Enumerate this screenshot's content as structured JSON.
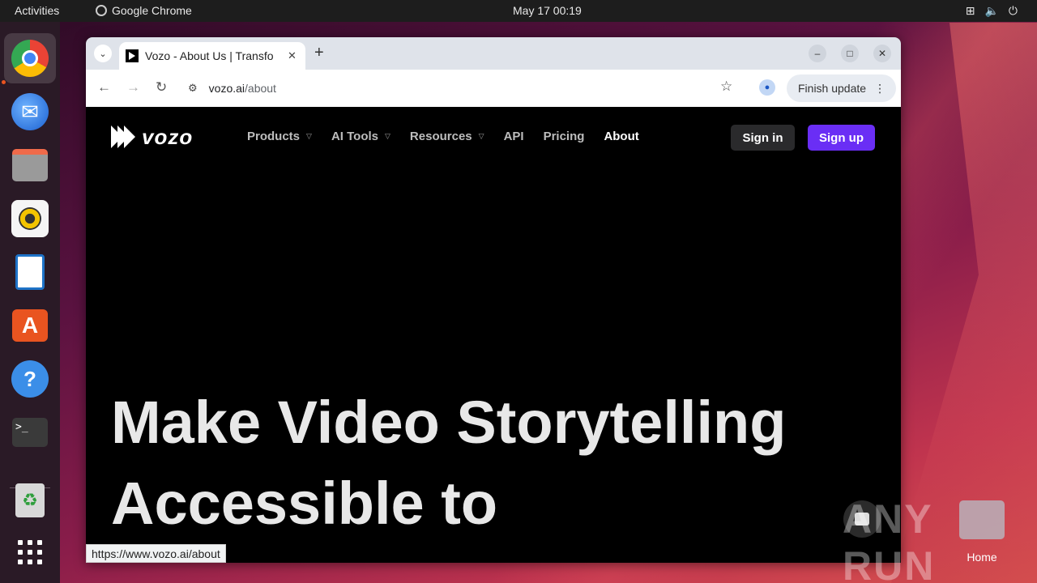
{
  "topbar": {
    "activities": "Activities",
    "app_name": "Google Chrome",
    "clock": "May 17  00:19"
  },
  "dock": {
    "items": [
      "chrome-icon",
      "thunderbird-icon",
      "files-icon",
      "rhythmbox-icon",
      "writer-icon",
      "app-center-icon",
      "help-icon",
      "terminal-icon",
      "trash-icon",
      "apps-grid-icon"
    ]
  },
  "browser": {
    "tab_title": "Vozo - About Us | Transfo",
    "url_host": "vozo.ai",
    "url_path": "/about",
    "finish_update": "Finish update",
    "status_url": "https://www.vozo.ai/about"
  },
  "site": {
    "logo_text": "vozo",
    "nav": [
      {
        "label": "Products",
        "has_menu": true
      },
      {
        "label": "AI Tools",
        "has_menu": true
      },
      {
        "label": "Resources",
        "has_menu": true
      },
      {
        "label": "API",
        "has_menu": false
      },
      {
        "label": "Pricing",
        "has_menu": false
      },
      {
        "label": "About",
        "has_menu": false
      }
    ],
    "sign_in": "Sign in",
    "sign_up": "Sign up",
    "hero_line1": "Make Video Storytelling",
    "hero_line2": "Accessible to"
  },
  "desktop": {
    "home_label": "Home",
    "watermark": "ANY RUN"
  },
  "colors": {
    "signup_bg": "#6a2ef5",
    "signin_bg": "#2a2a2c",
    "page_bg": "#000000"
  }
}
